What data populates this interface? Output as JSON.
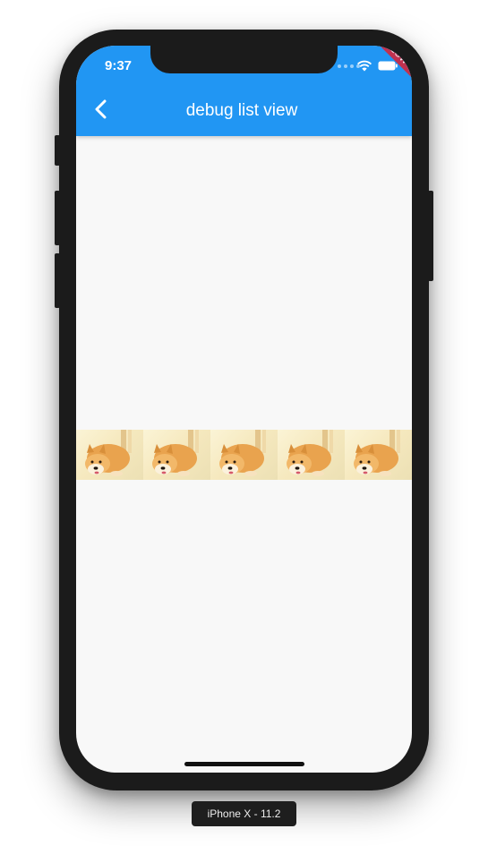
{
  "status_bar": {
    "time": "9:37",
    "banner": "SLOW MODE"
  },
  "app_bar": {
    "title": "debug list view",
    "back_icon": "chevron-left-icon",
    "color": "#2196f3"
  },
  "list": {
    "images": [
      {
        "alt": "shiba inu"
      },
      {
        "alt": "shiba inu"
      },
      {
        "alt": "shiba inu"
      },
      {
        "alt": "shiba inu"
      },
      {
        "alt": "shiba inu"
      }
    ]
  },
  "device_label": "iPhone X - 11.2"
}
